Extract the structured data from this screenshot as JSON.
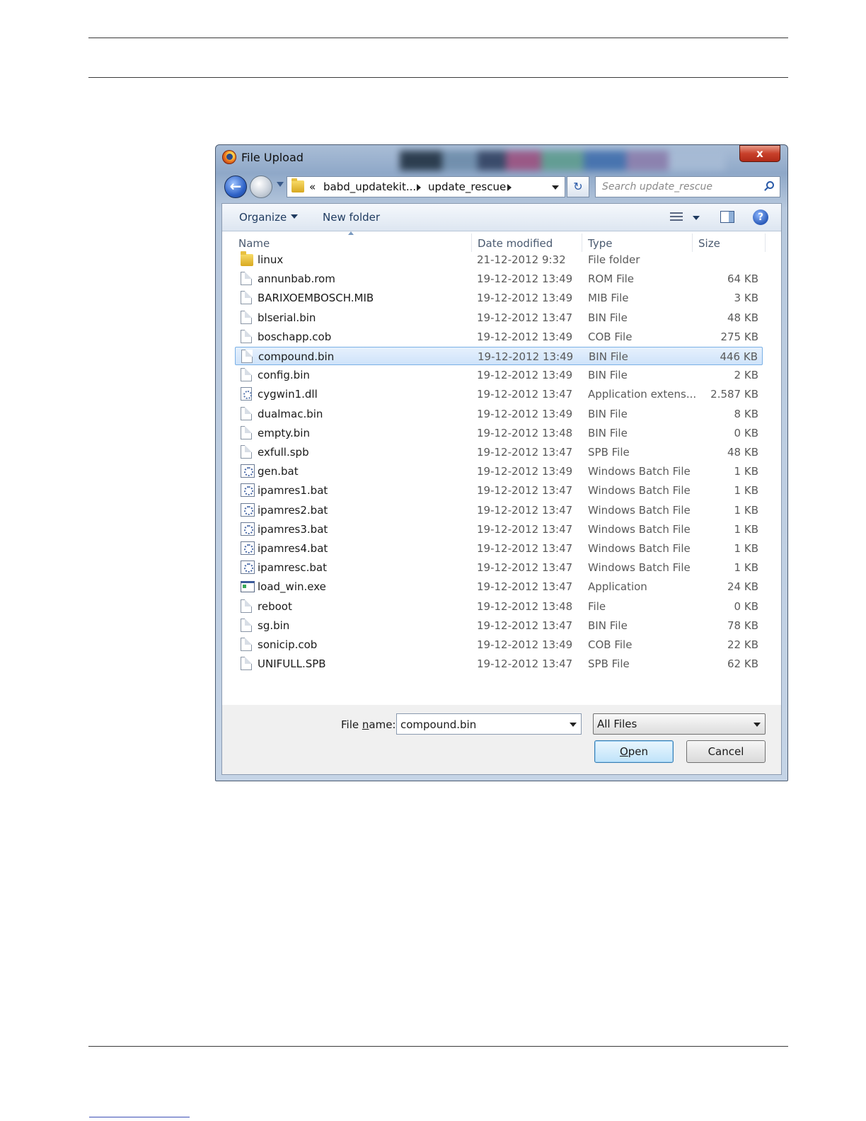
{
  "dialog": {
    "title": "File Upload",
    "close_label": "x"
  },
  "nav": {
    "address_overflow": "«",
    "address_segments": [
      "babd_updatekit...",
      "update_rescue"
    ],
    "search_placeholder": "Search update_rescue"
  },
  "toolbar": {
    "organize_label": "Organize",
    "new_folder_label": "New folder",
    "help_label": "?"
  },
  "columns": {
    "name": "Name",
    "date": "Date modified",
    "type": "Type",
    "size": "Size"
  },
  "files": [
    {
      "icon": "folder",
      "name": "linux",
      "date": "21-12-2012 9:32",
      "type": "File folder",
      "size": ""
    },
    {
      "icon": "file",
      "name": "annunbab.rom",
      "date": "19-12-2012 13:49",
      "type": "ROM File",
      "size": "64 KB"
    },
    {
      "icon": "file",
      "name": "BARIXOEMBOSCH.MIB",
      "date": "19-12-2012 13:49",
      "type": "MIB File",
      "size": "3 KB"
    },
    {
      "icon": "file",
      "name": "blserial.bin",
      "date": "19-12-2012 13:47",
      "type": "BIN File",
      "size": "48 KB"
    },
    {
      "icon": "file",
      "name": "boschapp.cob",
      "date": "19-12-2012 13:49",
      "type": "COB File",
      "size": "275 KB"
    },
    {
      "icon": "file",
      "name": "compound.bin",
      "date": "19-12-2012 13:49",
      "type": "BIN File",
      "size": "446 KB",
      "selected": true
    },
    {
      "icon": "file",
      "name": "config.bin",
      "date": "19-12-2012 13:49",
      "type": "BIN File",
      "size": "2 KB"
    },
    {
      "icon": "gear",
      "name": "cygwin1.dll",
      "date": "19-12-2012 13:47",
      "type": "Application extens...",
      "size": "2.587 KB"
    },
    {
      "icon": "file",
      "name": "dualmac.bin",
      "date": "19-12-2012 13:49",
      "type": "BIN File",
      "size": "8 KB"
    },
    {
      "icon": "file",
      "name": "empty.bin",
      "date": "19-12-2012 13:48",
      "type": "BIN File",
      "size": "0 KB"
    },
    {
      "icon": "file",
      "name": "exfull.spb",
      "date": "19-12-2012 13:47",
      "type": "SPB File",
      "size": "48 KB"
    },
    {
      "icon": "bat",
      "name": "gen.bat",
      "date": "19-12-2012 13:49",
      "type": "Windows Batch File",
      "size": "1 KB"
    },
    {
      "icon": "bat",
      "name": "ipamres1.bat",
      "date": "19-12-2012 13:47",
      "type": "Windows Batch File",
      "size": "1 KB"
    },
    {
      "icon": "bat",
      "name": "ipamres2.bat",
      "date": "19-12-2012 13:47",
      "type": "Windows Batch File",
      "size": "1 KB"
    },
    {
      "icon": "bat",
      "name": "ipamres3.bat",
      "date": "19-12-2012 13:47",
      "type": "Windows Batch File",
      "size": "1 KB"
    },
    {
      "icon": "bat",
      "name": "ipamres4.bat",
      "date": "19-12-2012 13:47",
      "type": "Windows Batch File",
      "size": "1 KB"
    },
    {
      "icon": "bat",
      "name": "ipamresc.bat",
      "date": "19-12-2012 13:47",
      "type": "Windows Batch File",
      "size": "1 KB"
    },
    {
      "icon": "exe",
      "name": "load_win.exe",
      "date": "19-12-2012 13:47",
      "type": "Application",
      "size": "24 KB"
    },
    {
      "icon": "file",
      "name": "reboot",
      "date": "19-12-2012 13:48",
      "type": "File",
      "size": "0 KB"
    },
    {
      "icon": "file",
      "name": "sg.bin",
      "date": "19-12-2012 13:47",
      "type": "BIN File",
      "size": "78 KB"
    },
    {
      "icon": "file",
      "name": "sonicip.cob",
      "date": "19-12-2012 13:49",
      "type": "COB File",
      "size": "22 KB"
    },
    {
      "icon": "file",
      "name": "UNIFULL.SPB",
      "date": "19-12-2012 13:47",
      "type": "SPB File",
      "size": "62 KB"
    }
  ],
  "footer": {
    "filename_label_pre": "File ",
    "filename_label_ul": "n",
    "filename_label_post": "ame:",
    "filename_value": "compound.bin",
    "filetype_value": "All Files",
    "open_ul": "O",
    "open_rest": "pen",
    "cancel_label": "Cancel"
  }
}
